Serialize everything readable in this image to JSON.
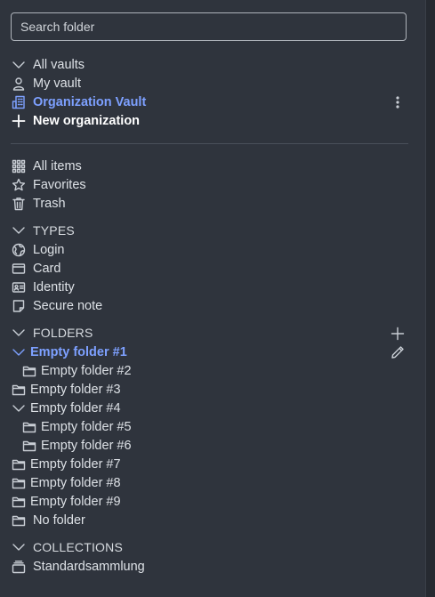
{
  "search": {
    "placeholder": "Search folder"
  },
  "vaults": {
    "all_vaults": "All vaults",
    "my_vault": "My vault",
    "organization_vault": "Organization Vault",
    "new_organization": "New organization"
  },
  "filters": {
    "all_items": "All items",
    "favorites": "Favorites",
    "trash": "Trash"
  },
  "types": {
    "heading": "TYPES",
    "login": "Login",
    "card": "Card",
    "identity": "Identity",
    "secure_note": "Secure note"
  },
  "folders": {
    "heading": "FOLDERS",
    "items": [
      "Empty folder #1",
      "Empty folder #2",
      "Empty folder #3",
      "Empty folder #4",
      "Empty folder #5",
      "Empty folder #6",
      "Empty folder #7",
      "Empty folder #8",
      "Empty folder #9",
      "No folder"
    ]
  },
  "collections": {
    "heading": "COLLECTIONS",
    "items": [
      "Standardsammlung"
    ]
  },
  "colors": {
    "background": "#2f343d",
    "accent": "#7da0ff",
    "text": "#dde1e6"
  }
}
